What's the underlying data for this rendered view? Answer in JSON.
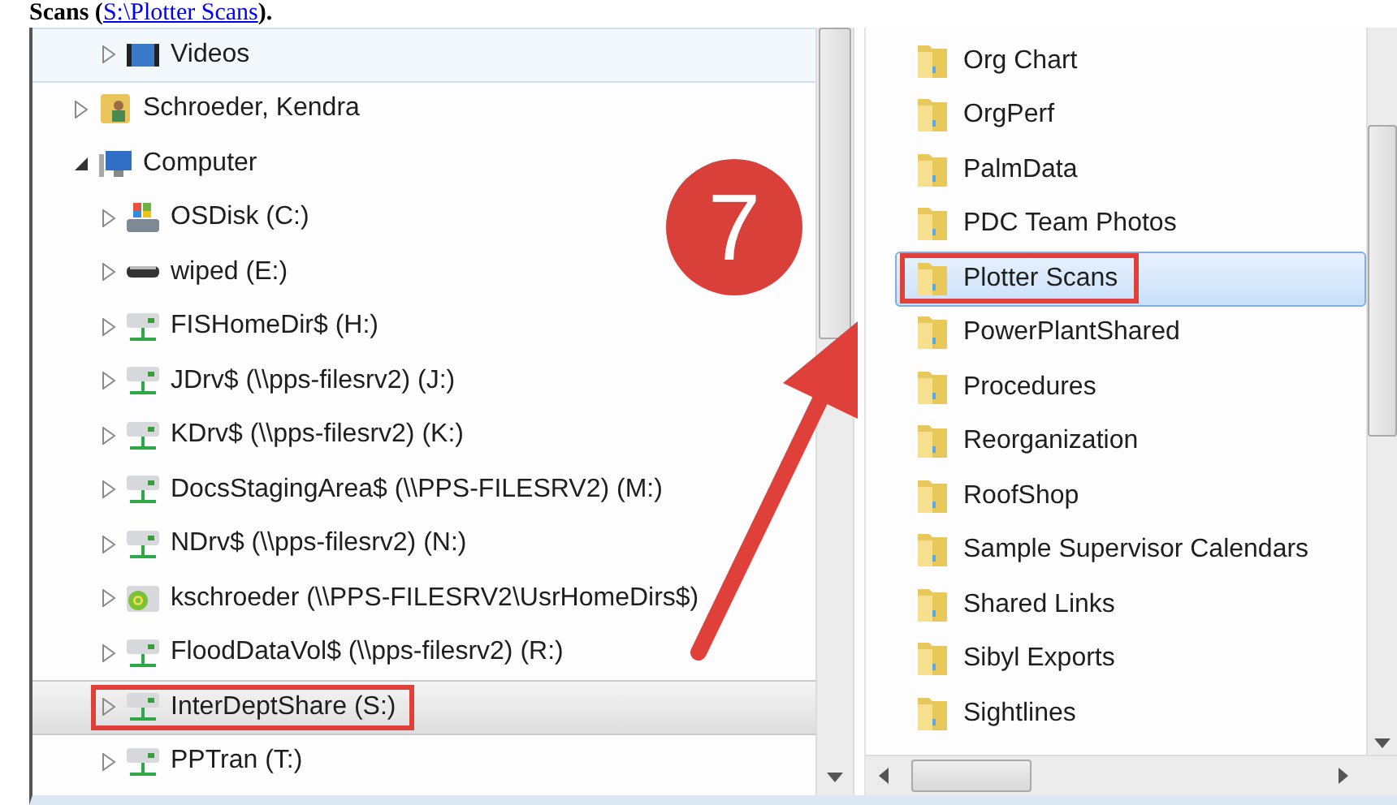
{
  "caption": {
    "prefix": "Scans (",
    "link": "S:\\Plotter Scans",
    "suffix": ")."
  },
  "tree": {
    "cut_branch": [
      {
        "label": "Videos",
        "kind": "library",
        "expanded": false,
        "selected": false,
        "hover": true,
        "highlighted": false
      }
    ],
    "items": [
      {
        "label": "Schroeder, Kendra",
        "kind": "user",
        "expanded": false,
        "selected": false,
        "hover": false,
        "highlighted": false
      },
      {
        "label": "Computer",
        "kind": "computer",
        "expanded": true,
        "selected": false,
        "hover": false,
        "highlighted": false,
        "children": [
          {
            "label": "OSDisk (C:)",
            "kind": "osdisk",
            "expanded": false,
            "selected": false,
            "hover": false,
            "highlighted": false
          },
          {
            "label": "wiped (E:)",
            "kind": "removable",
            "expanded": false,
            "selected": false,
            "hover": false,
            "highlighted": false
          },
          {
            "label": "FISHomeDir$ (H:)",
            "kind": "network",
            "expanded": false,
            "selected": false,
            "hover": false,
            "highlighted": false
          },
          {
            "label": "JDrv$ (\\\\pps-filesrv2) (J:)",
            "kind": "network",
            "expanded": false,
            "selected": false,
            "hover": false,
            "highlighted": false
          },
          {
            "label": "KDrv$ (\\\\pps-filesrv2) (K:)",
            "kind": "network",
            "expanded": false,
            "selected": false,
            "hover": false,
            "highlighted": false
          },
          {
            "label": "DocsStagingArea$ (\\\\PPS-FILESRV2) (M:)",
            "kind": "network",
            "expanded": false,
            "selected": false,
            "hover": false,
            "highlighted": false
          },
          {
            "label": "NDrv$ (\\\\pps-filesrv2) (N:)",
            "kind": "network",
            "expanded": false,
            "selected": false,
            "hover": false,
            "highlighted": false
          },
          {
            "label": "kschroeder (\\\\PPS-FILESRV2\\UsrHomeDirs$)",
            "kind": "sync",
            "expanded": false,
            "selected": false,
            "hover": false,
            "highlighted": false
          },
          {
            "label": "FloodDataVol$ (\\\\pps-filesrv2) (R:)",
            "kind": "network",
            "expanded": false,
            "selected": false,
            "hover": false,
            "highlighted": false
          },
          {
            "label": "InterDeptShare (S:)",
            "kind": "network",
            "expanded": false,
            "selected": true,
            "hover": false,
            "highlighted": true
          },
          {
            "label": "PPTran (T:)",
            "kind": "network",
            "expanded": false,
            "selected": false,
            "hover": false,
            "highlighted": false
          }
        ]
      }
    ]
  },
  "folders": [
    {
      "label": "Org Chart",
      "selected": false,
      "highlighted": false
    },
    {
      "label": "OrgPerf",
      "selected": false,
      "highlighted": false
    },
    {
      "label": "PalmData",
      "selected": false,
      "highlighted": false
    },
    {
      "label": "PDC Team Photos",
      "selected": false,
      "highlighted": false
    },
    {
      "label": "Plotter Scans",
      "selected": true,
      "highlighted": true
    },
    {
      "label": "PowerPlantShared",
      "selected": false,
      "highlighted": false
    },
    {
      "label": "Procedures",
      "selected": false,
      "highlighted": false
    },
    {
      "label": "Reorganization",
      "selected": false,
      "highlighted": false
    },
    {
      "label": "RoofShop",
      "selected": false,
      "highlighted": false
    },
    {
      "label": "Sample Supervisor Calendars",
      "selected": false,
      "highlighted": false
    },
    {
      "label": "Shared Links",
      "selected": false,
      "highlighted": false
    },
    {
      "label": "Sibyl Exports",
      "selected": false,
      "highlighted": false
    },
    {
      "label": "Sightlines",
      "selected": false,
      "highlighted": false
    }
  ],
  "step_badge": "7"
}
